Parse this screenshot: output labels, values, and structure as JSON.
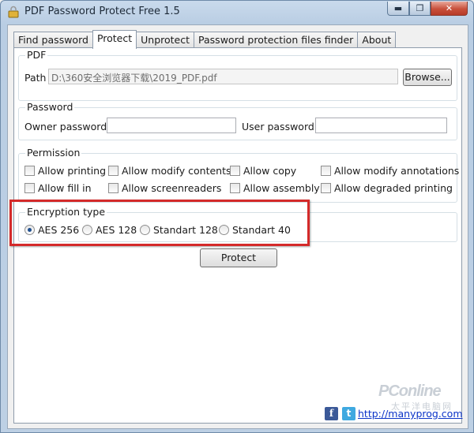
{
  "window": {
    "title": "PDF Password Protect Free 1.5",
    "minimize": "▬",
    "maximize": "❐",
    "close": "✕"
  },
  "tabs": [
    {
      "label": "Find password"
    },
    {
      "label": "Protect"
    },
    {
      "label": "Unprotect"
    },
    {
      "label": "Password protection files finder"
    },
    {
      "label": "About"
    }
  ],
  "pdf": {
    "group_title": "PDF",
    "path_label": "Path",
    "path_value": "D:\\360安全浏览器下载\\2019_PDF.pdf",
    "browse_label": "Browse..."
  },
  "password": {
    "group_title": "Password",
    "owner_label": "Owner password",
    "owner_value": "",
    "user_label": "User password",
    "user_value": ""
  },
  "permission": {
    "group_title": "Permission",
    "options": [
      {
        "label": "Allow printing",
        "checked": false
      },
      {
        "label": "Allow modify contents",
        "checked": false
      },
      {
        "label": "Allow copy",
        "checked": false
      },
      {
        "label": "Allow modify annotations",
        "checked": false
      },
      {
        "label": "Allow fill in",
        "checked": false
      },
      {
        "label": "Allow screenreaders",
        "checked": false
      },
      {
        "label": "Allow assembly",
        "checked": false
      },
      {
        "label": "Allow degraded printing",
        "checked": false
      }
    ]
  },
  "encryption": {
    "group_title": "Encryption type",
    "options": [
      {
        "label": "AES 256",
        "selected": true
      },
      {
        "label": "AES 128",
        "selected": false
      },
      {
        "label": "Standart 128",
        "selected": false
      },
      {
        "label": "Standart 40",
        "selected": false
      }
    ],
    "highlight_color": "#d42a2a"
  },
  "protect_button": "Protect",
  "footer": {
    "facebook_glyph": "f",
    "twitter_glyph": "t",
    "link": "http://manyprog.com"
  },
  "watermark": {
    "brand": "PConline",
    "sub": "太平洋电脑网"
  }
}
